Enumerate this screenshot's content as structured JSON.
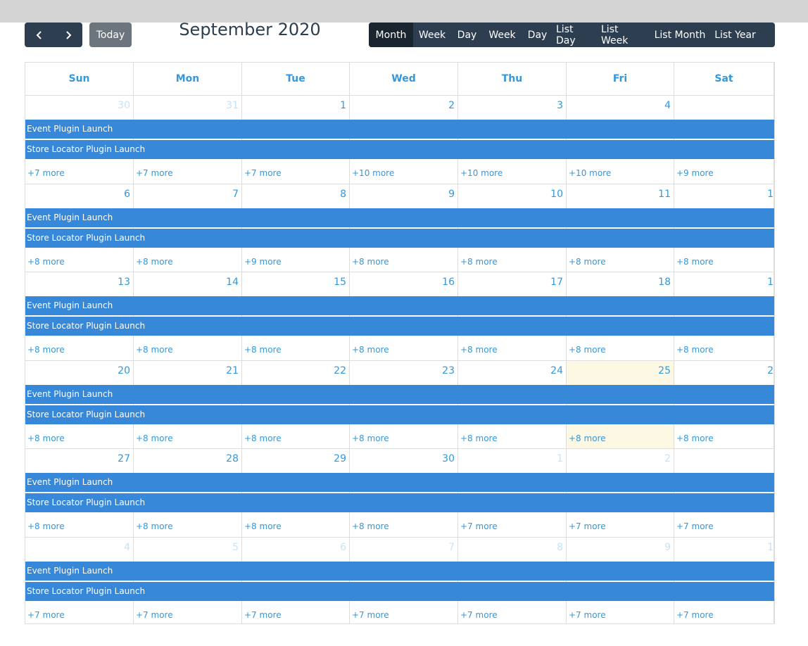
{
  "toolbar": {
    "prev_icon": "chevron-left-icon",
    "next_icon": "chevron-right-icon",
    "today_label": "Today",
    "title": "September 2020",
    "views": [
      "Month",
      "Week",
      "Day",
      "Week",
      "Day",
      "List Day",
      "List Week",
      "List Month",
      "List Year"
    ],
    "active_view": "Month"
  },
  "calendar": {
    "weekdays": [
      "Sun",
      "Mon",
      "Tue",
      "Wed",
      "Thu",
      "Fri",
      "Sat"
    ],
    "events": [
      "Event Plugin Launch",
      "Store Locator Plugin Launch"
    ],
    "weeks": [
      {
        "days": [
          {
            "num": "30",
            "other": true,
            "more": "+7 more"
          },
          {
            "num": "31",
            "other": true,
            "more": "+7 more"
          },
          {
            "num": "1",
            "more": "+7 more"
          },
          {
            "num": "2",
            "more": "+10 more"
          },
          {
            "num": "3",
            "more": "+10 more"
          },
          {
            "num": "4",
            "more": "+10 more"
          },
          {
            "num": "",
            "more": "+9 more"
          }
        ]
      },
      {
        "days": [
          {
            "num": "6",
            "more": "+8 more"
          },
          {
            "num": "7",
            "more": "+8 more"
          },
          {
            "num": "8",
            "more": "+9 more"
          },
          {
            "num": "9",
            "more": "+8 more"
          },
          {
            "num": "10",
            "more": "+8 more"
          },
          {
            "num": "11",
            "more": "+8 more"
          },
          {
            "num": "1",
            "more": "+8 more"
          }
        ]
      },
      {
        "days": [
          {
            "num": "13",
            "more": "+8 more"
          },
          {
            "num": "14",
            "more": "+8 more"
          },
          {
            "num": "15",
            "more": "+8 more"
          },
          {
            "num": "16",
            "more": "+8 more"
          },
          {
            "num": "17",
            "more": "+8 more"
          },
          {
            "num": "18",
            "more": "+8 more"
          },
          {
            "num": "1",
            "more": "+8 more"
          }
        ]
      },
      {
        "days": [
          {
            "num": "20",
            "more": "+8 more"
          },
          {
            "num": "21",
            "more": "+8 more"
          },
          {
            "num": "22",
            "more": "+8 more"
          },
          {
            "num": "23",
            "more": "+8 more"
          },
          {
            "num": "24",
            "more": "+8 more"
          },
          {
            "num": "25",
            "today": true,
            "more": "+8 more"
          },
          {
            "num": "2",
            "more": "+8 more"
          }
        ]
      },
      {
        "days": [
          {
            "num": "27",
            "more": "+8 more"
          },
          {
            "num": "28",
            "more": "+8 more"
          },
          {
            "num": "29",
            "more": "+8 more"
          },
          {
            "num": "30",
            "more": "+8 more"
          },
          {
            "num": "1",
            "other": true,
            "more": "+7 more"
          },
          {
            "num": "2",
            "other": true,
            "more": "+7 more"
          },
          {
            "num": "",
            "other": true,
            "more": "+7 more"
          }
        ]
      },
      {
        "days": [
          {
            "num": "4",
            "other": true,
            "more": "+7 more"
          },
          {
            "num": "5",
            "other": true,
            "more": "+7 more"
          },
          {
            "num": "6",
            "other": true,
            "more": "+7 more"
          },
          {
            "num": "7",
            "other": true,
            "more": "+7 more"
          },
          {
            "num": "8",
            "other": true,
            "more": "+7 more"
          },
          {
            "num": "9",
            "other": true,
            "more": "+7 more"
          },
          {
            "num": "1",
            "other": true,
            "more": "+7 more"
          }
        ]
      }
    ]
  }
}
